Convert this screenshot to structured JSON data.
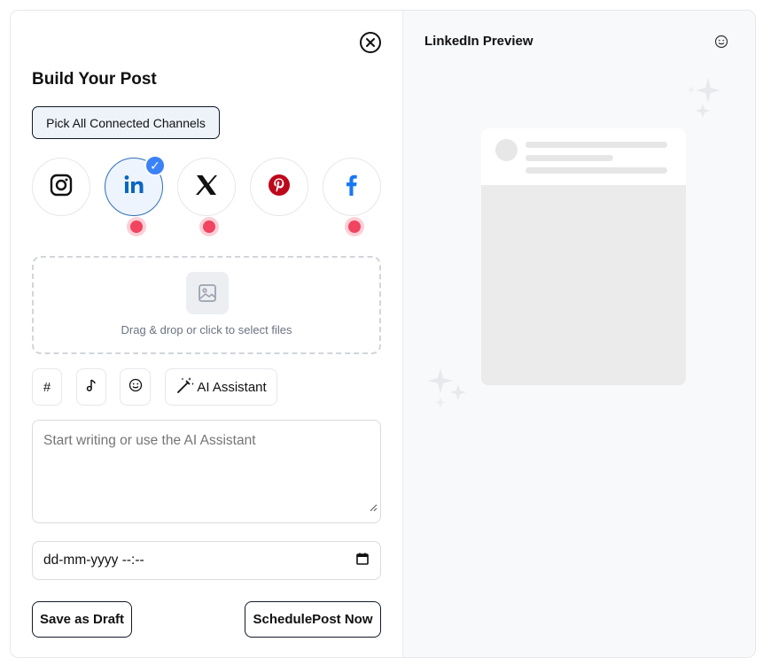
{
  "composer": {
    "title": "Build Your Post",
    "pick_all_label": "Pick All Connected Channels",
    "channels": [
      {
        "name": "Instagram",
        "icon": "instagram-icon",
        "selected": false,
        "has_alert": false
      },
      {
        "name": "LinkedIn",
        "icon": "linkedin-icon",
        "selected": true,
        "has_alert": true
      },
      {
        "name": "X",
        "icon": "x-icon",
        "selected": false,
        "has_alert": true
      },
      {
        "name": "Pinterest",
        "icon": "pinterest-icon",
        "selected": false,
        "has_alert": false
      },
      {
        "name": "Facebook",
        "icon": "facebook-icon",
        "selected": false,
        "has_alert": true
      }
    ],
    "upload": {
      "text": "Drag & drop or click to select files",
      "icon": "image-icon"
    },
    "tools": {
      "hashtag_label": "#",
      "ai_label": "AI Assistant"
    },
    "editor": {
      "placeholder": "Start writing or use the AI Assistant",
      "value": ""
    },
    "schedule": {
      "value": "dd-mm-yyyy --:--"
    },
    "buttons": {
      "draft": "Save as Draft",
      "schedule": "SchedulePost Now"
    }
  },
  "preview": {
    "title": "LinkedIn Preview"
  },
  "colors": {
    "accent": "#3b82f6",
    "linkedin": "#0a66c2",
    "pinterest": "#bd081c",
    "facebook": "#1877f2",
    "alert": "#f04461",
    "preview_bg": "#f8f9fb"
  }
}
